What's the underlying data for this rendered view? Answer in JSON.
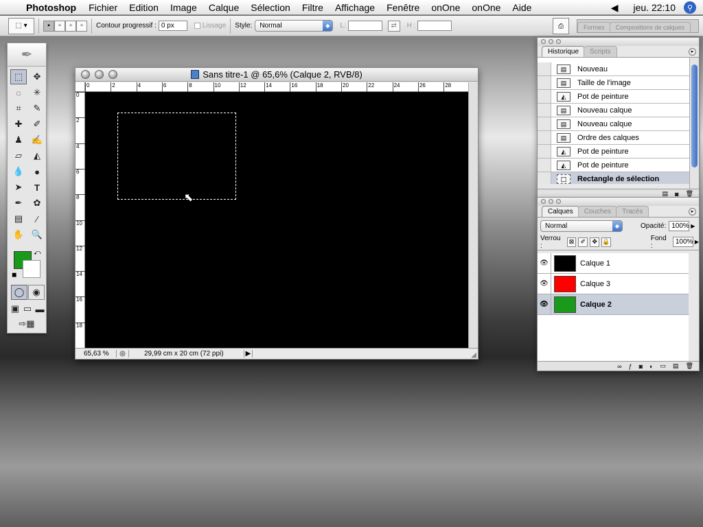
{
  "menubar": {
    "app": "Photoshop",
    "items": [
      "Fichier",
      "Edition",
      "Image",
      "Calque",
      "Sélection",
      "Filtre",
      "Affichage",
      "Fenêtre",
      "onOne",
      "onOne",
      "Aide"
    ],
    "clock": "jeu. 22:10"
  },
  "options": {
    "feather_label": "Contour progressif :",
    "feather_value": "0 px",
    "antialias_label": "Lissage",
    "style_label": "Style:",
    "style_value": "Normal",
    "width_label": "L:",
    "height_label": "H :",
    "well_tab1": "Formes",
    "well_tab2": "Compositions de calques"
  },
  "document": {
    "title": "Sans titre-1 @ 65,6% (Calque 2, RVB/8)",
    "zoom": "65,63 %",
    "size": "29,99 cm x 20 cm (72 ppi)",
    "ruler_h": [
      "0",
      "2",
      "4",
      "6",
      "8",
      "10",
      "12",
      "14",
      "16",
      "18",
      "20",
      "22",
      "24",
      "26",
      "28"
    ],
    "ruler_v": [
      "0",
      "2",
      "4",
      "6",
      "8",
      "10",
      "12",
      "14",
      "16",
      "18"
    ]
  },
  "history": {
    "tabs": [
      "Historique",
      "Scripts"
    ],
    "items": [
      "Nouveau",
      "Taille de l'image",
      "Pot de peinture",
      "Nouveau calque",
      "Nouveau calque",
      "Ordre des calques",
      "Pot de peinture",
      "Pot de peinture",
      "Rectangle de sélection"
    ]
  },
  "layers": {
    "tabs": [
      "Calques",
      "Couches",
      "Tracés"
    ],
    "blend": "Normal",
    "opacity_label": "Opacité:",
    "opacity": "100%",
    "lock_label": "Verrou :",
    "fill_label": "Fond :",
    "fill": "100%",
    "items": [
      {
        "name": "Calque 1",
        "color": "#000000"
      },
      {
        "name": "Calque 3",
        "color": "#ff0000"
      },
      {
        "name": "Calque 2",
        "color": "#1a9a1a"
      }
    ]
  },
  "colors": {
    "foreground": "#1a9a1a",
    "background": "#ffffff"
  }
}
